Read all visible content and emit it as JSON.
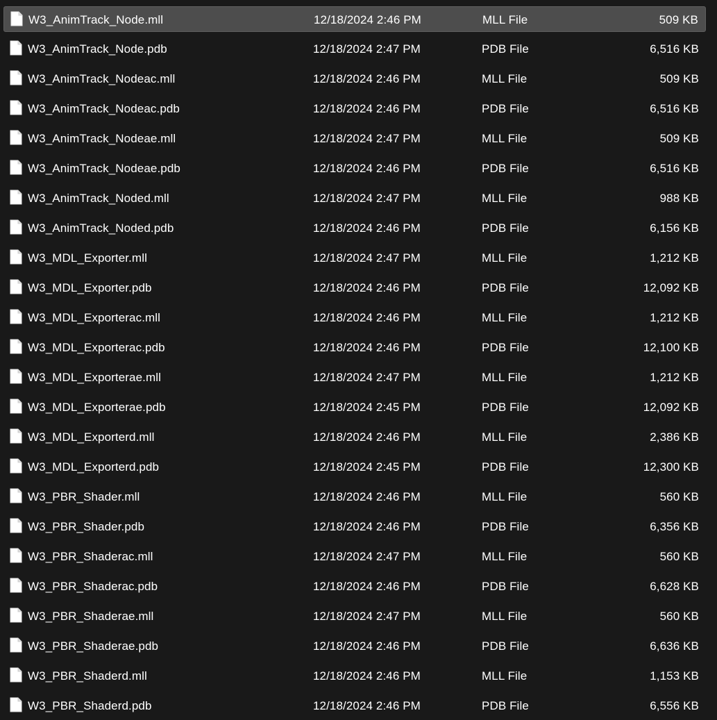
{
  "files": [
    {
      "name": "W3_AnimTrack_Node.mll",
      "date": "12/18/2024 2:46 PM",
      "type": "MLL File",
      "size": "509 KB",
      "selected": true
    },
    {
      "name": "W3_AnimTrack_Node.pdb",
      "date": "12/18/2024 2:47 PM",
      "type": "PDB File",
      "size": "6,516 KB"
    },
    {
      "name": "W3_AnimTrack_Nodeac.mll",
      "date": "12/18/2024 2:46 PM",
      "type": "MLL File",
      "size": "509 KB"
    },
    {
      "name": "W3_AnimTrack_Nodeac.pdb",
      "date": "12/18/2024 2:46 PM",
      "type": "PDB File",
      "size": "6,516 KB"
    },
    {
      "name": "W3_AnimTrack_Nodeae.mll",
      "date": "12/18/2024 2:47 PM",
      "type": "MLL File",
      "size": "509 KB"
    },
    {
      "name": "W3_AnimTrack_Nodeae.pdb",
      "date": "12/18/2024 2:46 PM",
      "type": "PDB File",
      "size": "6,516 KB"
    },
    {
      "name": "W3_AnimTrack_Noded.mll",
      "date": "12/18/2024 2:47 PM",
      "type": "MLL File",
      "size": "988 KB"
    },
    {
      "name": "W3_AnimTrack_Noded.pdb",
      "date": "12/18/2024 2:46 PM",
      "type": "PDB File",
      "size": "6,156 KB"
    },
    {
      "name": "W3_MDL_Exporter.mll",
      "date": "12/18/2024 2:47 PM",
      "type": "MLL File",
      "size": "1,212 KB"
    },
    {
      "name": "W3_MDL_Exporter.pdb",
      "date": "12/18/2024 2:46 PM",
      "type": "PDB File",
      "size": "12,092 KB"
    },
    {
      "name": "W3_MDL_Exporterac.mll",
      "date": "12/18/2024 2:46 PM",
      "type": "MLL File",
      "size": "1,212 KB"
    },
    {
      "name": "W3_MDL_Exporterac.pdb",
      "date": "12/18/2024 2:46 PM",
      "type": "PDB File",
      "size": "12,100 KB"
    },
    {
      "name": "W3_MDL_Exporterae.mll",
      "date": "12/18/2024 2:47 PM",
      "type": "MLL File",
      "size": "1,212 KB"
    },
    {
      "name": "W3_MDL_Exporterae.pdb",
      "date": "12/18/2024 2:45 PM",
      "type": "PDB File",
      "size": "12,092 KB"
    },
    {
      "name": "W3_MDL_Exporterd.mll",
      "date": "12/18/2024 2:46 PM",
      "type": "MLL File",
      "size": "2,386 KB"
    },
    {
      "name": "W3_MDL_Exporterd.pdb",
      "date": "12/18/2024 2:45 PM",
      "type": "PDB File",
      "size": "12,300 KB"
    },
    {
      "name": "W3_PBR_Shader.mll",
      "date": "12/18/2024 2:46 PM",
      "type": "MLL File",
      "size": "560 KB"
    },
    {
      "name": "W3_PBR_Shader.pdb",
      "date": "12/18/2024 2:46 PM",
      "type": "PDB File",
      "size": "6,356 KB"
    },
    {
      "name": "W3_PBR_Shaderac.mll",
      "date": "12/18/2024 2:47 PM",
      "type": "MLL File",
      "size": "560 KB"
    },
    {
      "name": "W3_PBR_Shaderac.pdb",
      "date": "12/18/2024 2:46 PM",
      "type": "PDB File",
      "size": "6,628 KB"
    },
    {
      "name": "W3_PBR_Shaderae.mll",
      "date": "12/18/2024 2:47 PM",
      "type": "MLL File",
      "size": "560 KB"
    },
    {
      "name": "W3_PBR_Shaderae.pdb",
      "date": "12/18/2024 2:46 PM",
      "type": "PDB File",
      "size": "6,636 KB"
    },
    {
      "name": "W3_PBR_Shaderd.mll",
      "date": "12/18/2024 2:46 PM",
      "type": "MLL File",
      "size": "1,153 KB"
    },
    {
      "name": "W3_PBR_Shaderd.pdb",
      "date": "12/18/2024 2:46 PM",
      "type": "PDB File",
      "size": "6,556 KB"
    }
  ],
  "icons": {
    "file": "file-icon"
  },
  "colors": {
    "background": "#191919",
    "selected_row": "#4d4d4d",
    "text": "#ffffff"
  }
}
